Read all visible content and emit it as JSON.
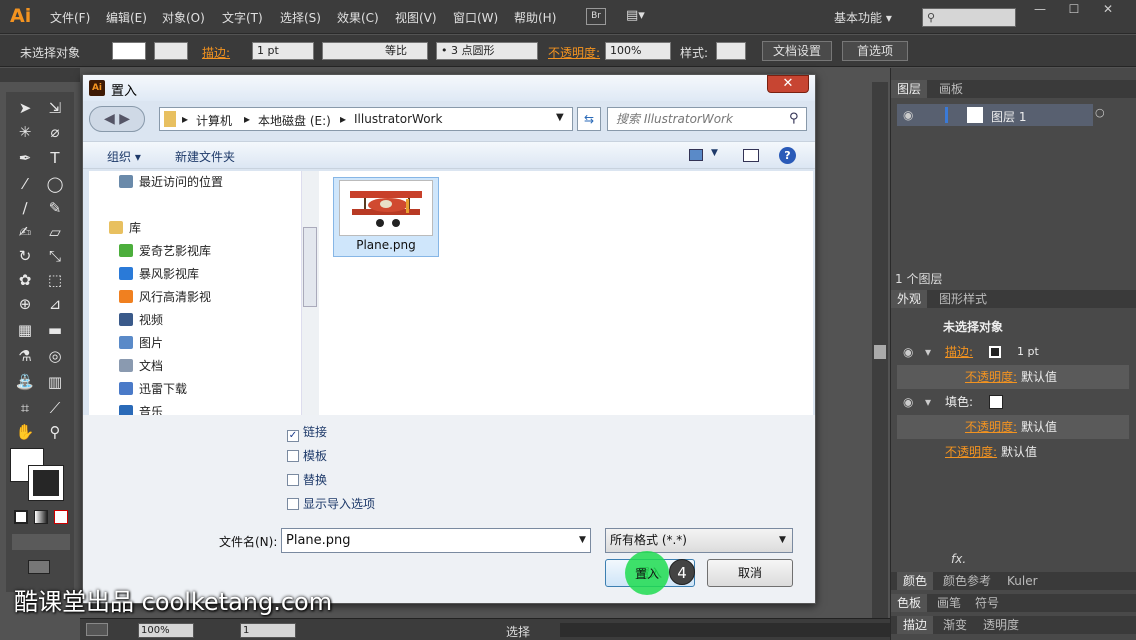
{
  "app": {
    "logo": "Ai"
  },
  "menu": [
    "文件(F)",
    "编辑(E)",
    "对象(O)",
    "文字(T)",
    "选择(S)",
    "效果(C)",
    "视图(V)",
    "窗口(W)",
    "帮助(H)"
  ],
  "top_right": {
    "bridge": "Br",
    "arrange": "▤▾",
    "workspace": "基本功能 ▾",
    "search_placeholder": "⚲",
    "min": "—",
    "max": "☐",
    "close": "✕"
  },
  "control_bar": {
    "selection": "未选择对象",
    "stroke_label": "描边:",
    "stroke_weight": "1 pt",
    "stroke_style": "等比",
    "brush": "• 3 点圆形",
    "opacity_label": "不透明度:",
    "opacity_value": "100%",
    "style_label": "样式:",
    "doc_setup": "文档设置",
    "prefs": "首选项"
  },
  "status_bar": {
    "zoom": "100%",
    "artboard": "1",
    "mode": "选择"
  },
  "layers_panel": {
    "tabs": [
      "图层",
      "画板"
    ],
    "layer_name": "图层 1",
    "count": "1 个图层"
  },
  "appearance_panel": {
    "tabs": [
      "外观",
      "图形样式"
    ],
    "title": "未选择对象",
    "stroke_label": "描边:",
    "stroke_value": "1 pt",
    "opacity_label": "不透明度:",
    "default": "默认值",
    "fill_label": "填色:",
    "footer_fx": "fx."
  },
  "lower_tabs": [
    [
      "颜色",
      "颜色参考",
      "Kuler"
    ],
    [
      "色板",
      "画笔",
      "符号"
    ],
    [
      "描边",
      "渐变",
      "透明度"
    ]
  ],
  "dialog": {
    "title": "置入",
    "close": "✕",
    "breadcrumb": [
      "计算机",
      "本地磁盘 (E:)",
      "IllustratorWork"
    ],
    "search_placeholder": "搜索 IllustratorWork",
    "toolbar": {
      "organize": "组织 ▾",
      "new_folder": "新建文件夹"
    },
    "nav_items": [
      {
        "label": "最近访问的位置",
        "color": "#6a8aaa"
      },
      {
        "label": "库",
        "color": "#e8c060"
      },
      {
        "label": "爱奇艺影视库",
        "color": "#4cae3c"
      },
      {
        "label": "暴风影视库",
        "color": "#2a7ad8"
      },
      {
        "label": "风行高清影视",
        "color": "#f08020"
      },
      {
        "label": "视频",
        "color": "#3a5a8a"
      },
      {
        "label": "图片",
        "color": "#5a8ac8"
      },
      {
        "label": "文档",
        "color": "#8a9ab0"
      },
      {
        "label": "迅雷下载",
        "color": "#4a7ac8"
      },
      {
        "label": "音乐",
        "color": "#2a6ab8"
      }
    ],
    "file": {
      "name": "Plane.png"
    },
    "options": [
      {
        "label": "链接",
        "checked": "✓"
      },
      {
        "label": "模板",
        "checked": ""
      },
      {
        "label": "替换",
        "checked": ""
      },
      {
        "label": "显示导入选项",
        "checked": ""
      }
    ],
    "filename_label": "文件名(N):",
    "filename_value": "Plane.png",
    "filetype": "所有格式 (*.*)",
    "place_button": "置入",
    "cancel_button": "取消",
    "step_number": "4"
  },
  "watermark": "酷课堂出品 coolketang.com"
}
